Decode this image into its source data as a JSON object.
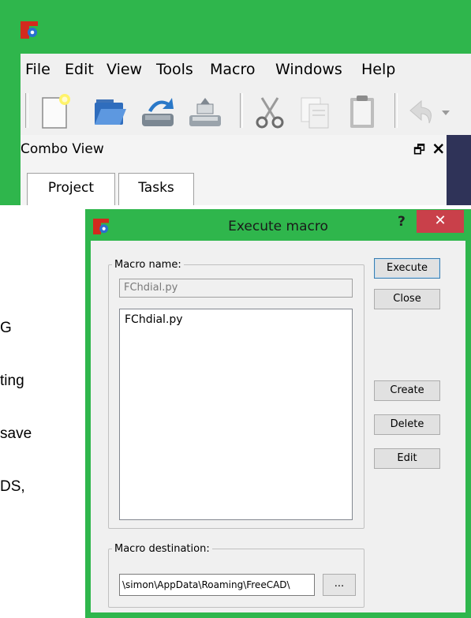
{
  "main_window": {
    "menu": [
      "File",
      "Edit",
      "View",
      "Tools",
      "Macro",
      "Windows",
      "Help"
    ],
    "combo_view": {
      "title": "Combo View",
      "tabs": [
        "Project",
        "Tasks"
      ]
    }
  },
  "background_text": [
    "G",
    "ting",
    "save",
    "DS,"
  ],
  "dialog": {
    "title": "Execute macro",
    "help_label": "?",
    "close_label": "✕",
    "macro_name_label": "Macro name:",
    "macro_name_value": "FChdial.py",
    "macro_list": [
      "FChdial.py"
    ],
    "macro_destination_label": "Macro destination:",
    "macro_destination_value": "\\simon\\AppData\\Roaming\\FreeCAD\\",
    "browse_label": "...",
    "buttons": {
      "execute": "Execute",
      "close": "Close",
      "create": "Create",
      "delete": "Delete",
      "edit": "Edit"
    }
  },
  "colors": {
    "window_frame": "#2fb64c",
    "close_button": "#c9404a"
  }
}
